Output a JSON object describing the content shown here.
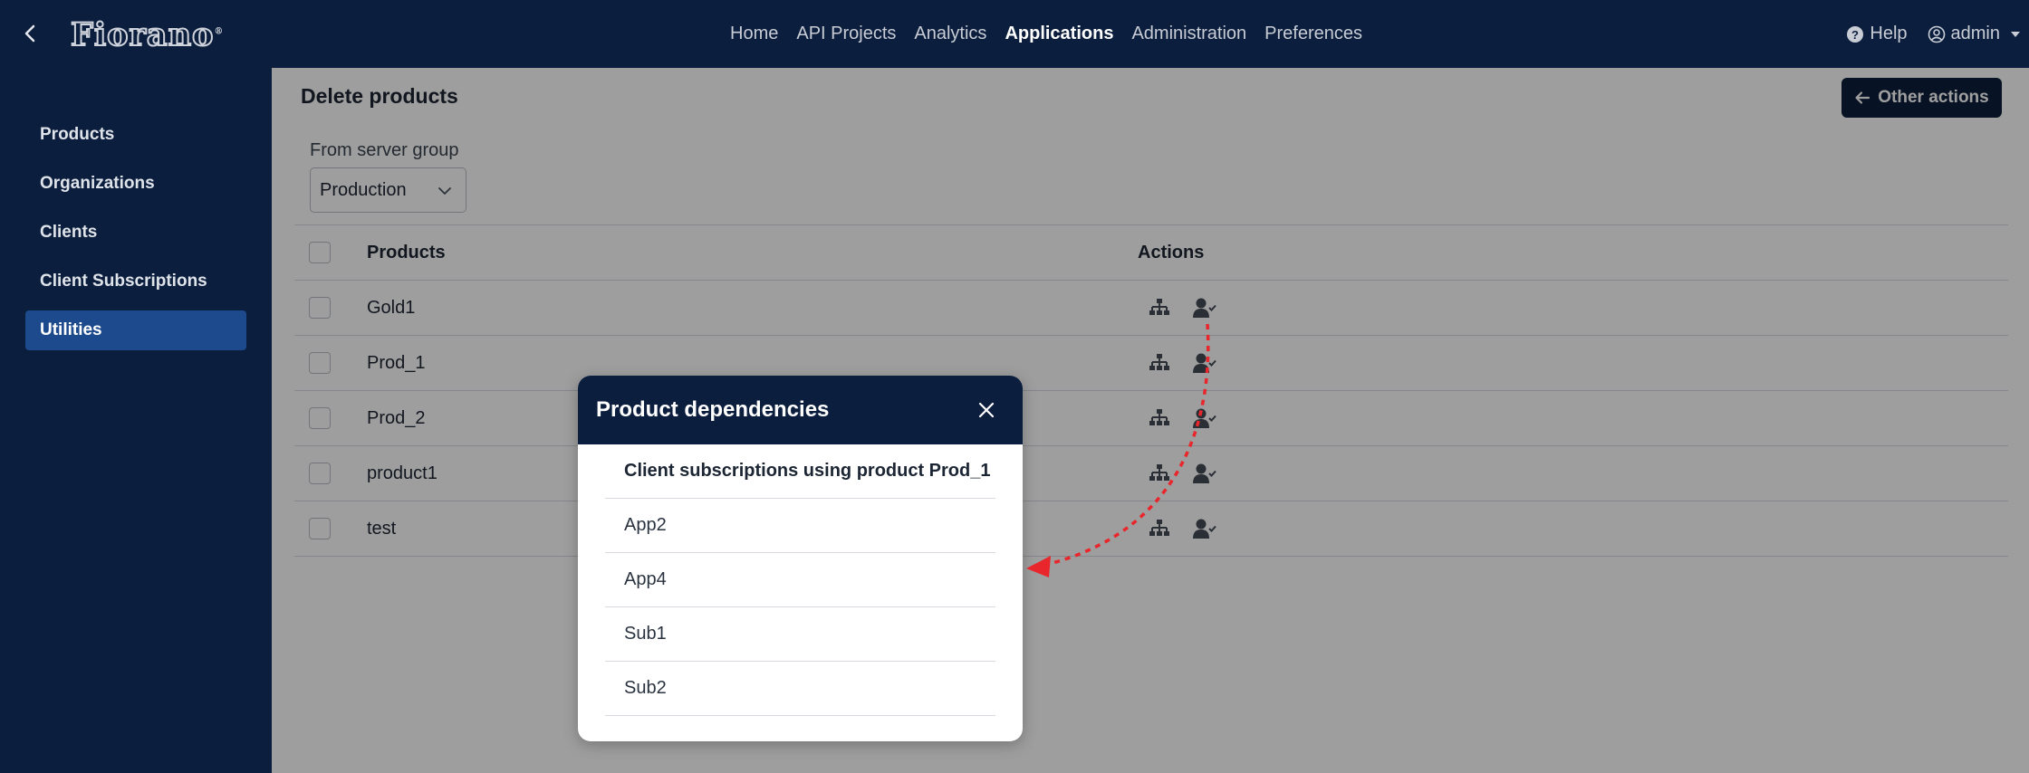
{
  "brand": {
    "logo_text": "Fiorano",
    "logo_mark": "®"
  },
  "topnav": {
    "items": [
      {
        "label": "Home",
        "active": false
      },
      {
        "label": "API Projects",
        "active": false
      },
      {
        "label": "Analytics",
        "active": false
      },
      {
        "label": "Applications",
        "active": true
      },
      {
        "label": "Administration",
        "active": false
      },
      {
        "label": "Preferences",
        "active": false
      }
    ],
    "help_label": "Help",
    "user_label": "admin"
  },
  "sidebar": {
    "items": [
      {
        "label": "Products",
        "active": false
      },
      {
        "label": "Organizations",
        "active": false
      },
      {
        "label": "Clients",
        "active": false
      },
      {
        "label": "Client Subscriptions",
        "active": false
      },
      {
        "label": "Utilities",
        "active": true
      }
    ]
  },
  "main": {
    "title": "Delete products",
    "other_actions_label": "Other actions",
    "server_group_label": "From server group",
    "server_group_value": "Production",
    "table": {
      "headers": {
        "products": "Products",
        "actions": "Actions"
      },
      "rows": [
        "Gold1",
        "Prod_1",
        "Prod_2",
        "product1",
        "test"
      ]
    }
  },
  "modal": {
    "title": "Product dependencies",
    "list_header": "Client subscriptions using product Prod_1",
    "items": [
      "App2",
      "App4",
      "Sub1",
      "Sub2"
    ]
  },
  "colors": {
    "nav_bg": "#0c1e3d",
    "active_sidebar": "#1c4a8c",
    "annotation_arrow": "#e8262b"
  }
}
